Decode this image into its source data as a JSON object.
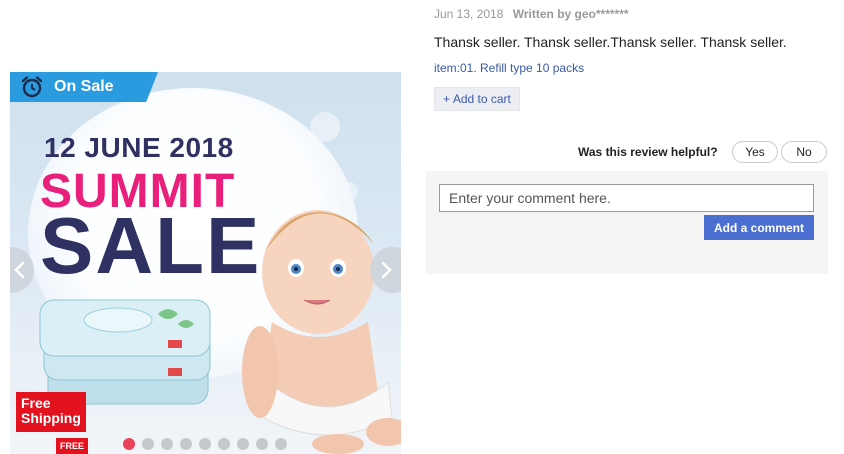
{
  "banner": {
    "on_sale_label": "On Sale",
    "date_line": "12 JUNE 2018",
    "headline_top": "SUMMIT",
    "headline_bottom": "SALE",
    "free_shipping_line1": "Free",
    "free_shipping_line2": "Shipping",
    "free_small": "FREE",
    "slide_count": 9,
    "active_slide": 1,
    "colors": {
      "tag": "#2b9be0",
      "summit": "#e8207b",
      "navy": "#2e3161",
      "shipping": "#e2121f",
      "active_dot": "#e8435a"
    }
  },
  "review": {
    "date": "Jun 13, 2018",
    "author": "Written by geo*******",
    "text": "Thansk seller. Thansk seller.Thansk seller. Thansk seller.",
    "item_variant": "item:01. Refill type 10 packs",
    "add_to_cart_label": "+ Add to cart",
    "helpful_question": "Was this review helpful?",
    "yes_label": "Yes",
    "no_label": "No"
  },
  "comment": {
    "placeholder": "Enter your comment here.",
    "submit_label": "Add a comment"
  },
  "icons": [
    "alarm-clock-icon",
    "chevron-left-icon",
    "chevron-right-icon"
  ]
}
